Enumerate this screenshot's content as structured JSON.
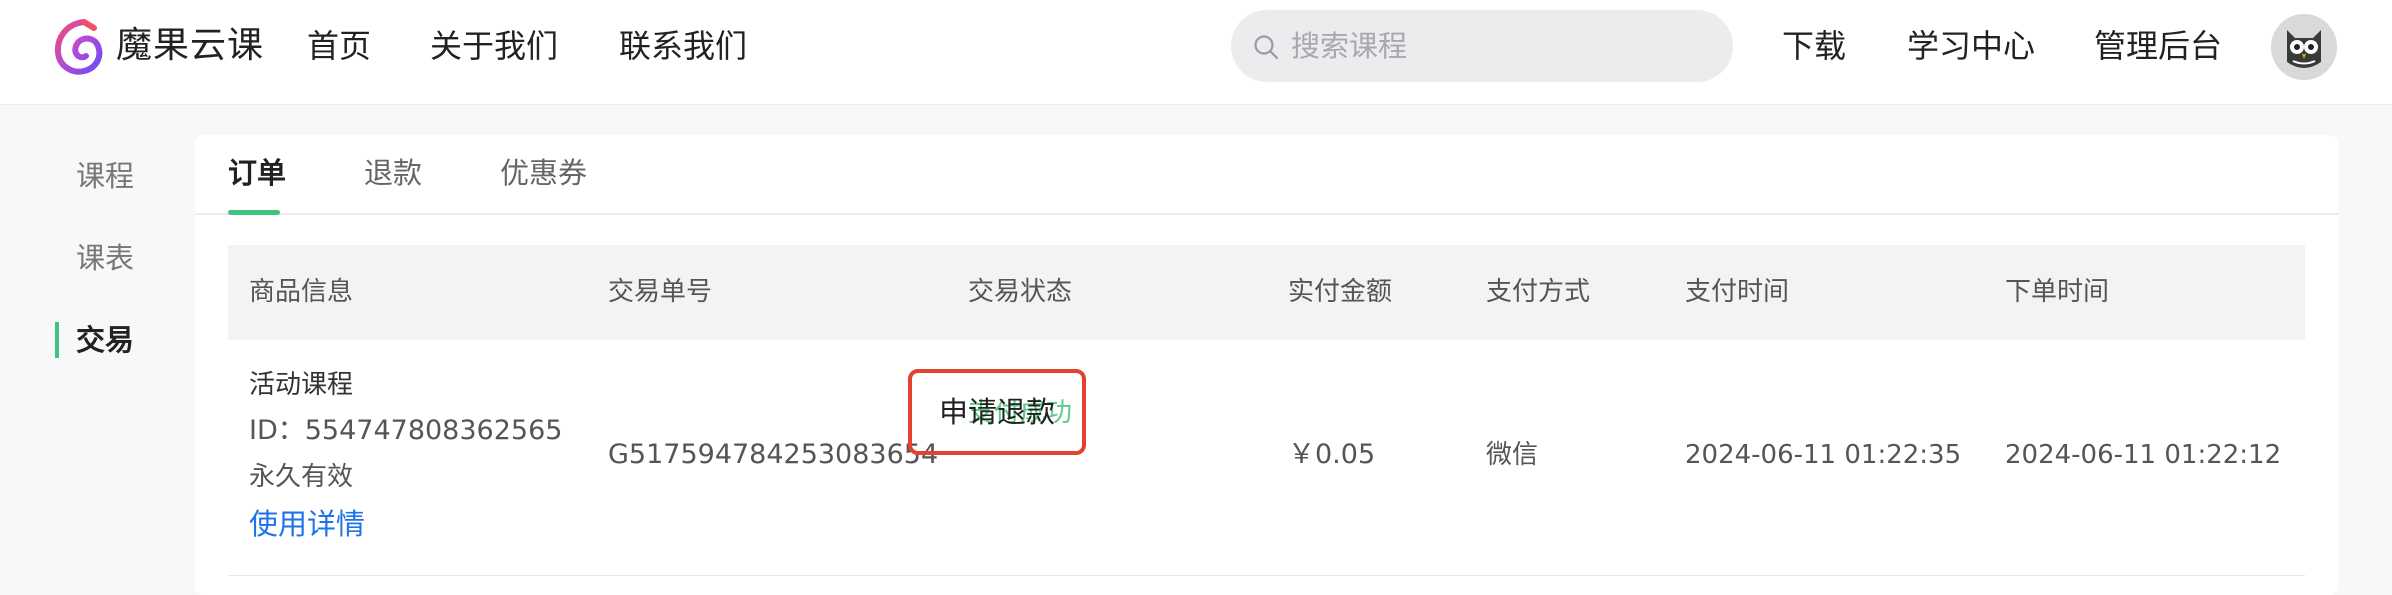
{
  "header": {
    "brand_name": "魔果云课",
    "nav": [
      "首页",
      "关于我们",
      "联系我们"
    ],
    "search": {
      "placeholder": "搜索课程",
      "value": ""
    },
    "right_nav": [
      "下载",
      "学习中心",
      "管理后台"
    ]
  },
  "sidebar": {
    "items": [
      "课程",
      "课表",
      "交易"
    ],
    "active_item": "交易"
  },
  "tabs": {
    "items": [
      "订单",
      "退款",
      "优惠券"
    ],
    "active_tab": "订单"
  },
  "table": {
    "columns": [
      "商品信息",
      "交易单号",
      "交易状态",
      "实付金额",
      "支付方式",
      "支付时间",
      "下单时间"
    ],
    "rows": [
      {
        "product_name": "活动课程",
        "product_id": "ID：554747808362565",
        "validity": "永久有效",
        "usage_link": "使用详情",
        "order_no": "G517594784253083654",
        "status": "支付成功",
        "refund_action": "申请退款",
        "amount": "￥0.05",
        "payment_method": "微信",
        "pay_time": "2024-06-11 01:22:35",
        "order_time": "2024-06-11 01:22:12"
      }
    ]
  },
  "colors": {
    "accent_green": "#3fc37e",
    "status_success": "#5ccb86",
    "link_blue": "#1f73e8",
    "highlight_red": "#e44130"
  },
  "icons": {
    "logo": "swirl-logo-icon",
    "search": "search-icon",
    "avatar": "owl-avatar-icon"
  }
}
